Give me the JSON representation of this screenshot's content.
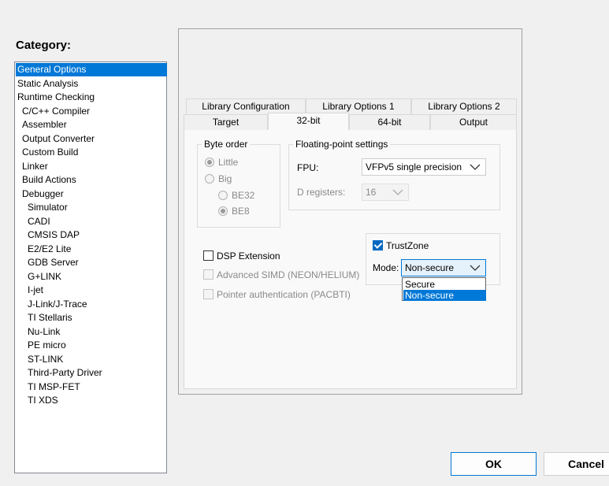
{
  "category": {
    "label": "Category:",
    "items": [
      {
        "label": "General Options",
        "selected": true
      },
      {
        "label": "Static Analysis"
      },
      {
        "label": "Runtime Checking"
      },
      {
        "label": "C/C++ Compiler"
      },
      {
        "label": "Assembler"
      },
      {
        "label": "Output Converter"
      },
      {
        "label": "Custom Build"
      },
      {
        "label": "Linker"
      },
      {
        "label": "Build Actions"
      },
      {
        "label": "Debugger"
      },
      {
        "label": "Simulator"
      },
      {
        "label": "CADI"
      },
      {
        "label": "CMSIS DAP"
      },
      {
        "label": "E2/E2 Lite"
      },
      {
        "label": "GDB Server"
      },
      {
        "label": "G+LINK"
      },
      {
        "label": "I-jet"
      },
      {
        "label": "J-Link/J-Trace"
      },
      {
        "label": "TI Stellaris"
      },
      {
        "label": "Nu-Link"
      },
      {
        "label": "PE micro"
      },
      {
        "label": "ST-LINK"
      },
      {
        "label": "Third-Party Driver"
      },
      {
        "label": "TI MSP-FET"
      },
      {
        "label": "TI XDS"
      }
    ]
  },
  "tabs": {
    "row1": [
      "Library Configuration",
      "Library Options 1",
      "Library Options 2"
    ],
    "row2": [
      "Target",
      "32-bit",
      "64-bit",
      "Output"
    ],
    "active": "32-bit"
  },
  "byte_order": {
    "legend": "Byte order",
    "little": "Little",
    "big": "Big",
    "be32": "BE32",
    "be8": "BE8"
  },
  "fp": {
    "legend": "Floating-point settings",
    "fpu_label": "FPU:",
    "fpu_value": "VFPv5 single precision",
    "dreg_label": "D registers:",
    "dreg_value": "16"
  },
  "checks": {
    "dsp": "DSP Extension",
    "simd": "Advanced SIMD (NEON/HELIUM)",
    "pac": "Pointer authentication (PACBTI)"
  },
  "trustzone": {
    "label": "TrustZone",
    "checked": true,
    "mode_label": "Mode:",
    "mode_value": "Non-secure",
    "options": [
      "Secure",
      "Non-secure"
    ],
    "selected_option": "Non-secure"
  },
  "buttons": {
    "ok": "OK",
    "cancel": "Cancel"
  },
  "colors": {
    "accent": "#0078d7"
  }
}
